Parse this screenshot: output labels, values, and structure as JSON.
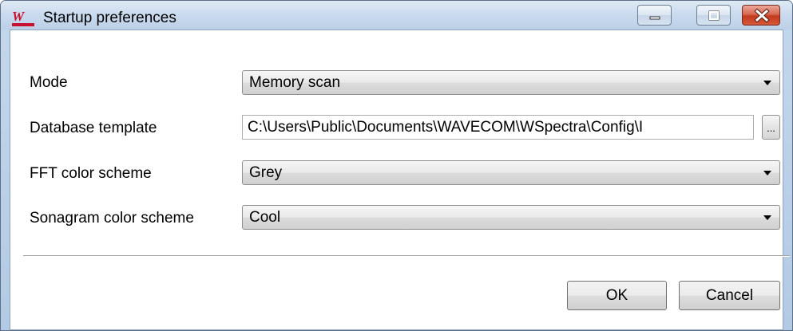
{
  "window": {
    "title": "Startup preferences",
    "icon": "wspectra-logo-icon",
    "controls": [
      "minimize-icon",
      "maximize-icon",
      "close-icon"
    ]
  },
  "form": {
    "mode": {
      "label": "Mode",
      "value": "Memory scan"
    },
    "database_template": {
      "label": "Database template",
      "value": "C:\\Users\\Public\\Documents\\WAVECOM\\WSpectra\\Config\\I",
      "browse_label": "..."
    },
    "fft_color_scheme": {
      "label": "FFT color scheme",
      "value": "Grey"
    },
    "sonagram_color_scheme": {
      "label": "Sonagram color scheme",
      "value": "Cool"
    }
  },
  "buttons": {
    "ok": "OK",
    "cancel": "Cancel"
  },
  "colors": {
    "title_bar": "#c9daee",
    "close_button": "#c43b1f",
    "logo_red": "#c8102e"
  }
}
